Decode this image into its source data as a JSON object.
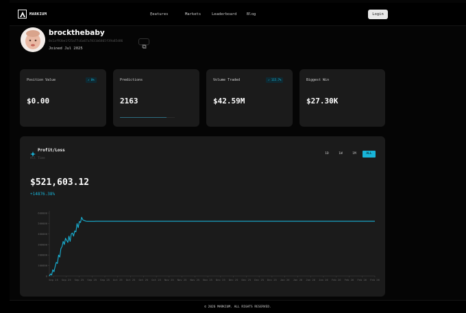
{
  "header": {
    "brand": "MARKIUM",
    "nav": [
      "Features",
      "Markets",
      "Leaderboard",
      "Blog"
    ],
    "login_label": "Login"
  },
  "profile": {
    "username": "brockthebaby",
    "address": "0x1af93be1f25a77c6a67a7831b6865f39a85d86",
    "joined": "Joined Jul 2025"
  },
  "stats": [
    {
      "label": "Position Value",
      "value": "$0.00",
      "badge": "↗ 0%"
    },
    {
      "label": "Predictions",
      "value": "2163",
      "progress": 0.85
    },
    {
      "label": "Volume Traded",
      "value": "$42.59M",
      "badge": "↗ 115.7%"
    },
    {
      "label": "Biggest Win",
      "value": "$27.30K"
    }
  ],
  "pnl": {
    "title": "Profit/Loss",
    "subtitle": "All Time",
    "value": "$521,603.12",
    "change": "+14876.38%",
    "ranges": [
      "1D",
      "1W",
      "1M",
      "ALL"
    ],
    "active_range": "ALL"
  },
  "chart_data": {
    "type": "line",
    "color": "#18b4d8",
    "ylim": [
      0,
      620000
    ],
    "yticks": [
      0,
      100000,
      200000,
      300000,
      400000,
      500000,
      600000
    ],
    "ytick_labels": [
      "0",
      "100000",
      "200000",
      "300000",
      "400000",
      "500000",
      "600000"
    ],
    "xticks": [
      "Sep 25",
      "Sep 25",
      "Sep 25",
      "Sep 25",
      "Sep 25",
      "Oct 25",
      "Oct 25",
      "Oct 25",
      "Oct 25",
      "Nov 25",
      "Nov 25",
      "Nov 25",
      "Nov 25",
      "Dec 25",
      "Dec 25",
      "Dec 25",
      "Dec 25",
      "Dec 25",
      "Jan 26",
      "Jan 26",
      "Jan 26",
      "Jan 26",
      "Feb 26",
      "Feb 26",
      "Feb 26",
      "Feb 26"
    ],
    "x": [
      0,
      1,
      2,
      3,
      4,
      5,
      6,
      7,
      8,
      9,
      10,
      11,
      12,
      13,
      14,
      15,
      16,
      17,
      18,
      19,
      20,
      21,
      22,
      23,
      24,
      25,
      26,
      27,
      28,
      29,
      30,
      31,
      32,
      33,
      34,
      35,
      36,
      37,
      38,
      39,
      40,
      45,
      50,
      60,
      80,
      100,
      120,
      140,
      160,
      180,
      200,
      220,
      240,
      260,
      282
    ],
    "y": [
      0,
      20000,
      10000,
      60000,
      40000,
      90000,
      130000,
      120000,
      200000,
      180000,
      260000,
      280000,
      330000,
      300000,
      360000,
      340000,
      320000,
      380000,
      330000,
      400000,
      410000,
      380000,
      430000,
      420000,
      500000,
      460000,
      520000,
      510000,
      560000,
      535000,
      530000,
      525000,
      522000,
      521000,
      521000,
      521000,
      521000,
      521000,
      521000,
      521000,
      521600,
      521600,
      521600,
      521600,
      521600,
      521600,
      521600,
      521600,
      521600,
      521600,
      521600,
      521600,
      521600,
      521600,
      521603
    ]
  },
  "footer": {
    "text": "© 2026 MARKIUM. ALL RIGHTS RESERVED."
  }
}
